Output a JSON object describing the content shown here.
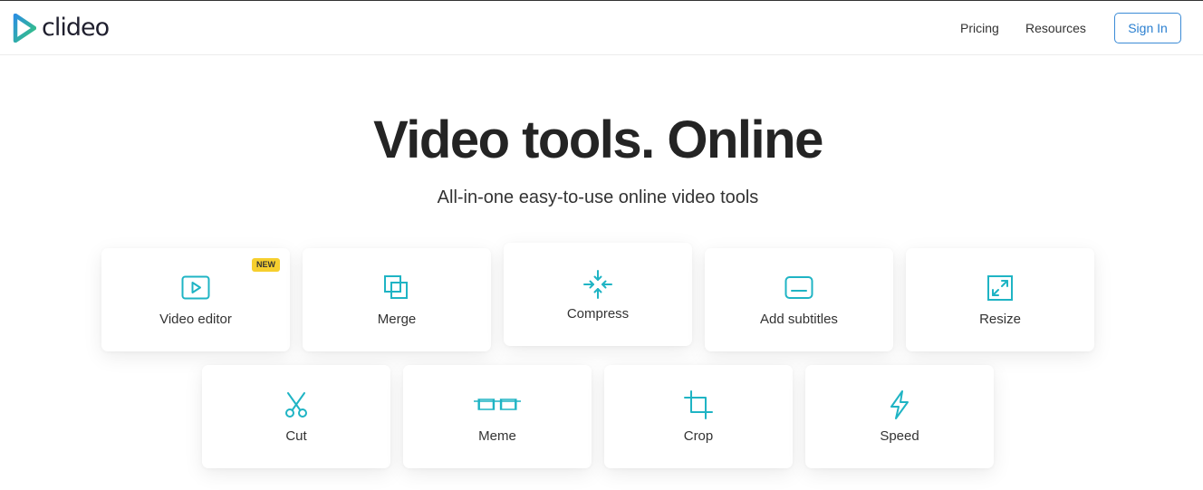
{
  "header": {
    "logo_text": "clideo",
    "nav": {
      "pricing": "Pricing",
      "resources": "Resources"
    },
    "signin_label": "Sign In"
  },
  "hero": {
    "title": "Video tools. Online",
    "subtitle": "All-in-one easy-to-use online video tools"
  },
  "tools": {
    "video_editor": {
      "label": "Video editor",
      "badge": "NEW",
      "icon": "play-icon"
    },
    "merge": {
      "label": "Merge",
      "icon": "merge-icon"
    },
    "compress": {
      "label": "Compress",
      "icon": "compress-icon"
    },
    "add_subtitles": {
      "label": "Add subtitles",
      "icon": "subtitles-icon"
    },
    "resize": {
      "label": "Resize",
      "icon": "resize-icon"
    },
    "cut": {
      "label": "Cut",
      "icon": "scissors-icon"
    },
    "meme": {
      "label": "Meme",
      "icon": "meme-icon"
    },
    "crop": {
      "label": "Crop",
      "icon": "crop-icon"
    },
    "speed": {
      "label": "Speed",
      "icon": "lightning-icon"
    }
  },
  "colors": {
    "accent_teal": "#1fb4c4",
    "signin_blue": "#2a7fd0",
    "badge_yellow": "#f6cf2e",
    "logo_green": "#35c77a",
    "logo_blue": "#2b8fe0"
  }
}
